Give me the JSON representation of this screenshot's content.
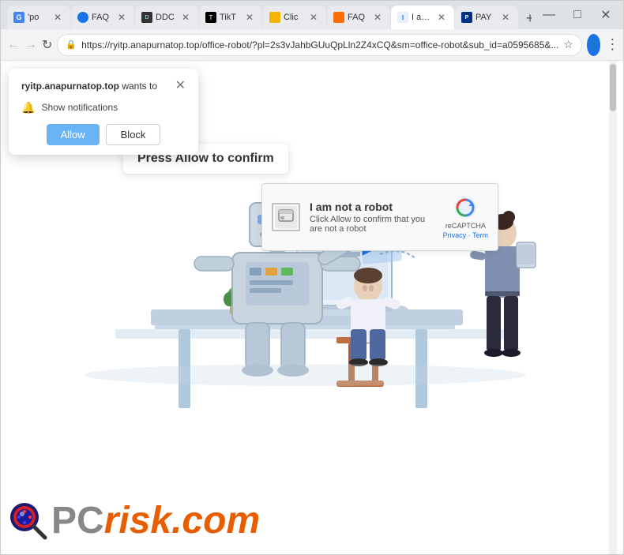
{
  "window": {
    "title": "I am not a robot",
    "controls": {
      "minimize": "—",
      "maximize": "□",
      "close": "✕"
    }
  },
  "tabs": [
    {
      "id": "tab-g",
      "label": "G 'po",
      "favicon_type": "fav-g",
      "active": false,
      "closeable": true
    },
    {
      "id": "tab-faq1",
      "label": "FAQ",
      "favicon_type": "fav-blue",
      "active": false,
      "closeable": true
    },
    {
      "id": "tab-ddc",
      "label": "DDC",
      "favicon_type": "fav-ddc",
      "active": false,
      "closeable": true
    },
    {
      "id": "tab-tik",
      "label": "TikT",
      "favicon_type": "fav-tik",
      "active": false,
      "closeable": true
    },
    {
      "id": "tab-cli",
      "label": "Clic",
      "favicon_type": "fav-cli",
      "active": false,
      "closeable": true
    },
    {
      "id": "tab-faq2",
      "label": "FAQ",
      "favicon_type": "fav-orange",
      "active": false,
      "closeable": true
    },
    {
      "id": "tab-iam",
      "label": "I am",
      "favicon_type": "fav-iam",
      "active": true,
      "closeable": true
    },
    {
      "id": "tab-pay",
      "label": "PAY",
      "favicon_type": "fav-pay",
      "active": false,
      "closeable": true
    }
  ],
  "address_bar": {
    "url": "https://ryitp.anapurnatop.top/office-robot/?pl=2s3vJahbGUuQpLln2Z4xCQ&sm=office-robot&sub_id=a0595685&...",
    "lock_icon": "🔒"
  },
  "notification_popup": {
    "site": "ryitp.anapurnatop.top",
    "wants_to_text": " wants to",
    "close_label": "✕",
    "notification_text": "Show notifications",
    "allow_label": "Allow",
    "block_label": "Block"
  },
  "press_allow": {
    "label": "Press Allow to confirm"
  },
  "recaptcha": {
    "title": "I am not a robot",
    "subtitle": "Click Allow to confirm that you are not a robot",
    "logo_text": "reCAPTCHA",
    "links": "Privacy · Term"
  },
  "pcrisk": {
    "pc_text": "PC",
    "risk_text": "risk",
    "com_text": ".com"
  }
}
